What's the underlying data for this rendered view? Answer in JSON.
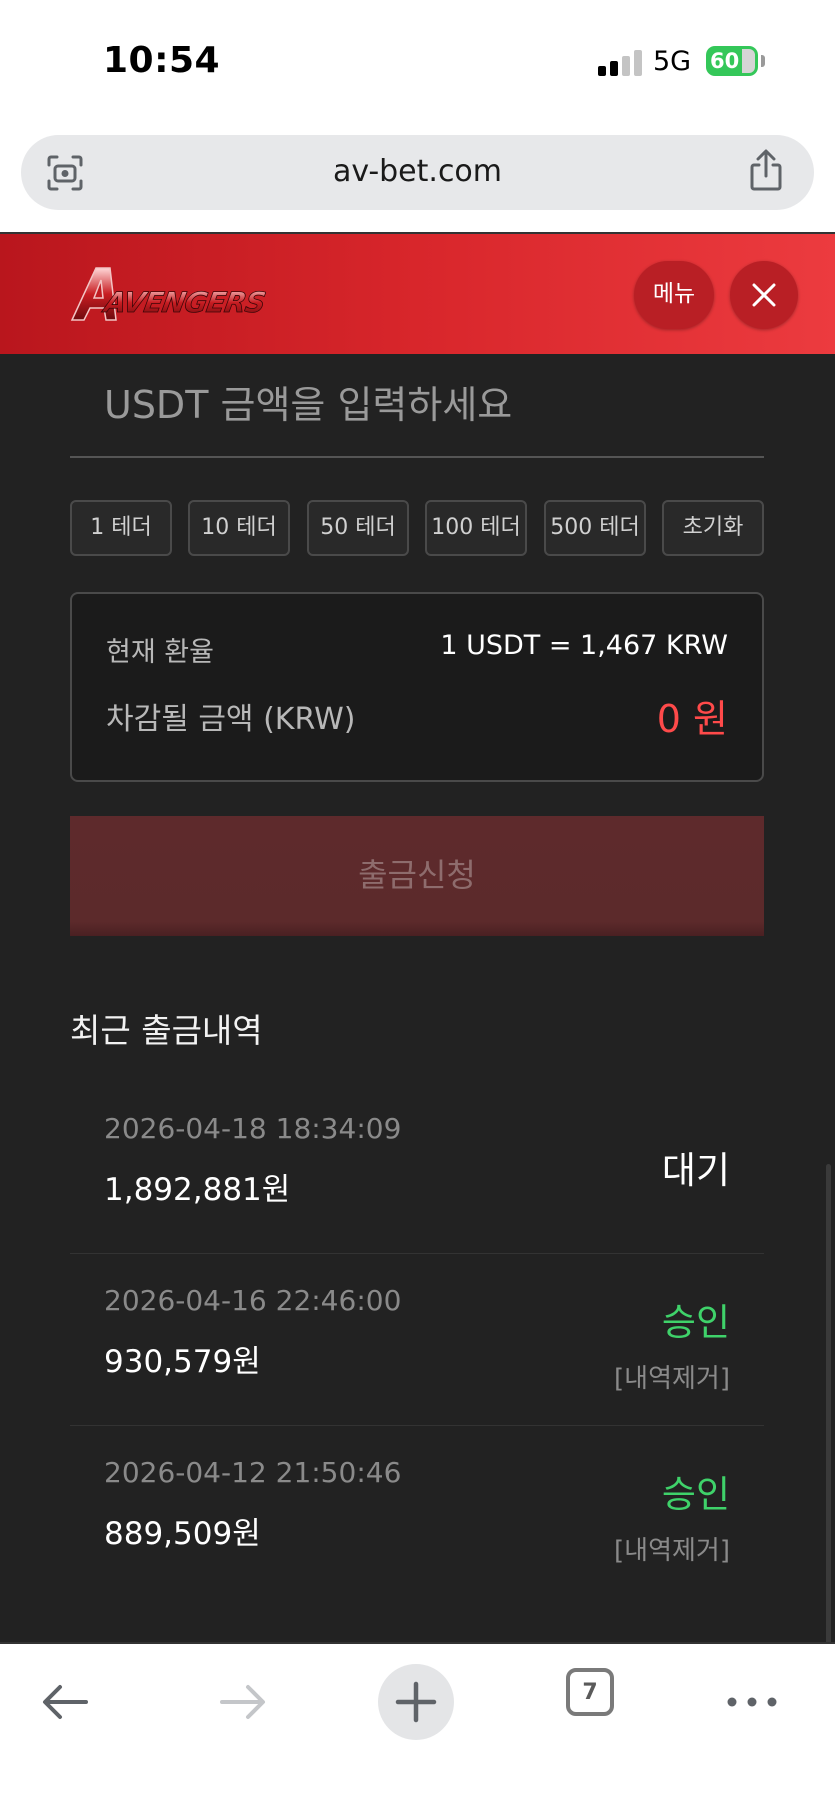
{
  "status_bar": {
    "time": "10:54",
    "network": "5G",
    "battery": "60"
  },
  "browser": {
    "url": "av-bet.com",
    "tab_count": "7"
  },
  "header": {
    "logo_text": "AVENGERS",
    "menu_label": "메뉴"
  },
  "form": {
    "amount_placeholder": "USDT 금액을 입력하세요",
    "quick_buttons": [
      "1 테더",
      "10 테더",
      "50 테더",
      "100 테더",
      "500 테더",
      "초기화"
    ],
    "rate_label": "현재 환율",
    "rate_value": "1 USDT = 1,467 KRW",
    "deduct_label": "차감될 금액 (KRW)",
    "deduct_value": "0 원",
    "submit_label": "출금신청"
  },
  "history": {
    "title": "최근 출금내역",
    "items": [
      {
        "date": "2026-04-18 18:34:09",
        "amount": "1,892,881원",
        "status": "대기",
        "remove": ""
      },
      {
        "date": "2026-04-16 22:46:00",
        "amount": "930,579원",
        "status": "승인",
        "remove": "[내역제거]"
      },
      {
        "date": "2026-04-12 21:50:46",
        "amount": "889,509원",
        "status": "승인",
        "remove": "[내역제거]"
      }
    ]
  },
  "colors": {
    "header_red": "#d8262b",
    "accent_red": "#ff4a4a",
    "approved_green": "#3fd26a",
    "background": "#222222"
  }
}
